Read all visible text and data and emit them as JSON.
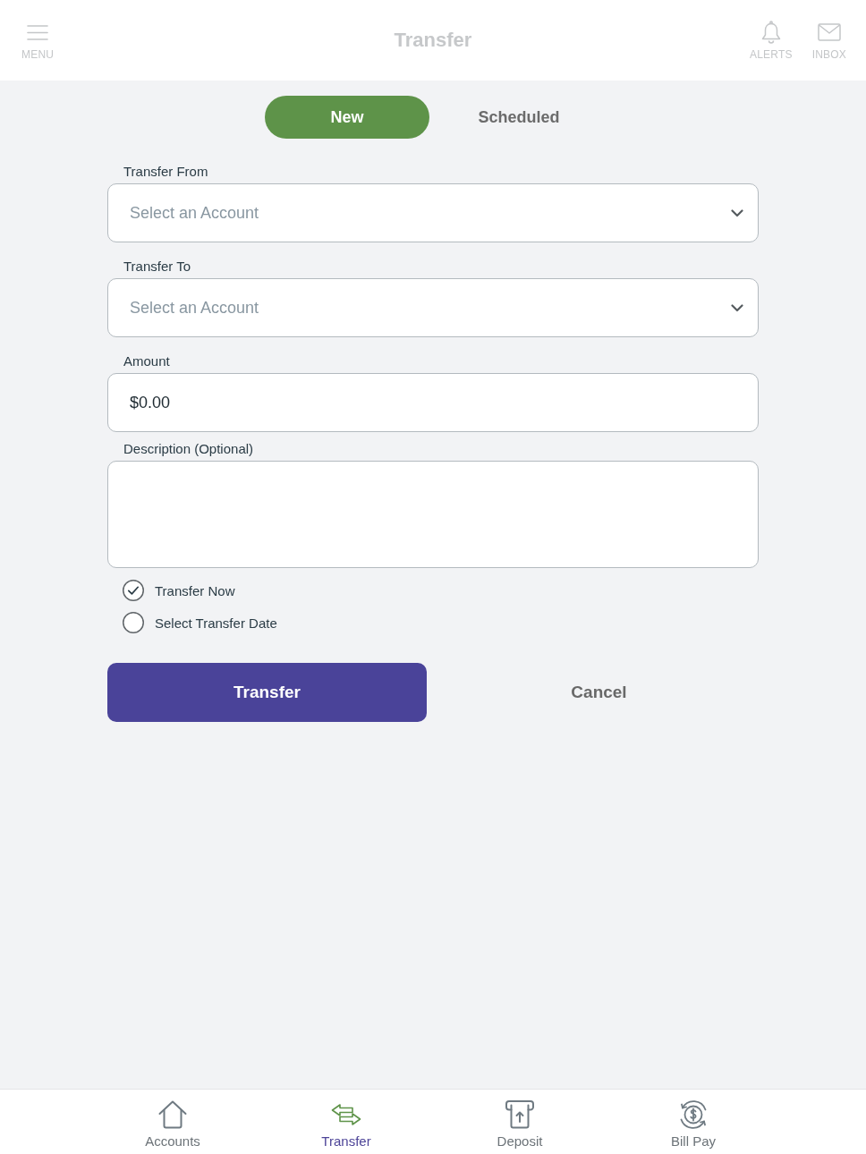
{
  "header": {
    "menu_label": "MENU",
    "title": "Transfer",
    "actions": [
      {
        "kind": "alerts",
        "label": "ALERTS"
      },
      {
        "kind": "inbox",
        "label": "INBOX"
      }
    ]
  },
  "tabs": [
    {
      "label": "New",
      "selected": true
    },
    {
      "label": "Scheduled",
      "selected": false
    }
  ],
  "form": {
    "fields": [
      {
        "kind": "select",
        "label": "Transfer From",
        "placeholder": "Select an Account"
      },
      {
        "kind": "select",
        "label": "Transfer To",
        "placeholder": "Select an Account"
      },
      {
        "kind": "input",
        "label": "Amount",
        "value": "$0.00"
      },
      {
        "kind": "textarea",
        "label": "Description (Optional)"
      }
    ],
    "timing_options": [
      {
        "label": "Transfer Now",
        "selected": true
      },
      {
        "label": "Select Transfer Date",
        "selected": false
      }
    ],
    "buttons": [
      {
        "kind": "primary",
        "label": "Transfer"
      },
      {
        "kind": "secondary",
        "label": "Cancel"
      }
    ]
  },
  "bottom_nav": [
    {
      "kind": "accounts",
      "label": "Accounts",
      "selected": false
    },
    {
      "kind": "transfer",
      "label": "Transfer",
      "selected": true
    },
    {
      "kind": "deposit",
      "label": "Deposit",
      "selected": false
    },
    {
      "kind": "billpay",
      "label": "Bill Pay",
      "selected": false
    }
  ]
}
